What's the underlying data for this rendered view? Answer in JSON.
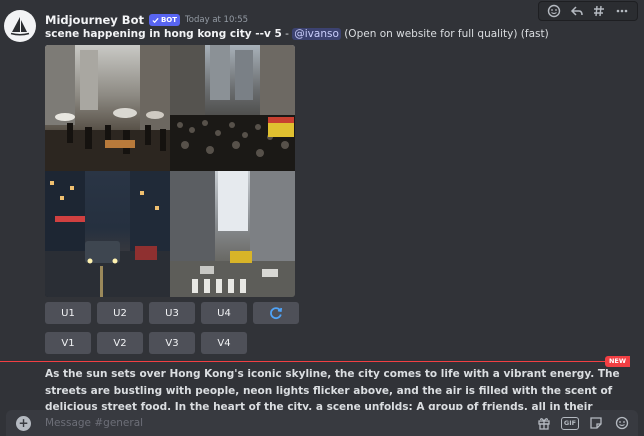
{
  "message": {
    "username": "Midjourney Bot",
    "bot_badge": "BOT",
    "timestamp": "Today at 10:55",
    "prompt": "scene happening in hong kong city --v 5",
    "separator": " - ",
    "mention": "@ivanso",
    "suffix": " (Open on website for full quality) (fast)"
  },
  "image_grid": {
    "description_icons": [
      "street-market-scene",
      "crowded-street-scene",
      "night-traffic-scene",
      "crosswalk-scene"
    ]
  },
  "buttons": {
    "upscale": [
      "U1",
      "U2",
      "U3",
      "U4"
    ],
    "variation": [
      "V1",
      "V2",
      "V3",
      "V4"
    ],
    "reroll_icon": "refresh-icon"
  },
  "new_badge": "NEW",
  "story_text": "As the sun sets over Hong Kong's iconic skyline, the city comes to life with a vibrant energy. The streets are bustling with people, neon lights flicker above, and the air is filled with the scent of delicious street food. In the heart of the city, a scene unfolds: A group of friends, all in their early twenties, walk down a crowded",
  "composer": {
    "placeholder": "Message #general",
    "gif_label": "GIF"
  },
  "colors": {
    "background": "#313338",
    "accent": "#5865f2",
    "new_red": "#f23f43",
    "button": "#4e5058"
  }
}
